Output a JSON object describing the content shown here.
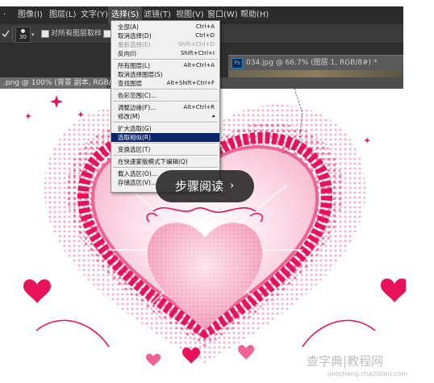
{
  "menubar": {
    "items": [
      {
        "label": "图像(I)",
        "active": false
      },
      {
        "label": "图层(L)",
        "active": false
      },
      {
        "label": "文字(Y)",
        "active": false
      },
      {
        "label": "选择(S)",
        "active": true
      },
      {
        "label": "滤镜(T)",
        "active": false
      },
      {
        "label": "视图(V)",
        "active": false
      },
      {
        "label": "窗口(W)",
        "active": false
      },
      {
        "label": "帮助(H)",
        "active": false
      }
    ]
  },
  "options_bar": {
    "brush_size": "30",
    "sample_all_layers_label": "对所有图层取样"
  },
  "documents": {
    "active_tab_label": ".png @ 100% (背景 副本, RGB/8) *",
    "second_window_label": "034.jpg @ 66.7% (图层 1, RGB/8#) *",
    "ps_icon_text": "Ps"
  },
  "select_menu": {
    "rows": [
      {
        "label": "全部(A)",
        "shortcut": "Ctrl+A",
        "state": "normal"
      },
      {
        "label": "取消选择(D)",
        "shortcut": "Ctrl+D",
        "state": "normal"
      },
      {
        "label": "重新选择(E)",
        "shortcut": "Shift+Ctrl+D",
        "state": "disabled"
      },
      {
        "label": "反向(I)",
        "shortcut": "Shift+Ctrl+I",
        "state": "normal"
      },
      {
        "label": "所有图层(L)",
        "shortcut": "Alt+Ctrl+A",
        "state": "normal"
      },
      {
        "label": "取消选择图层(S)",
        "shortcut": "",
        "state": "normal"
      },
      {
        "label": "查找图层",
        "shortcut": "Alt+Shift+Ctrl+F",
        "state": "normal"
      },
      {
        "label": "色彩范围(C)...",
        "shortcut": "",
        "state": "normal"
      },
      {
        "label": "调整边缘(F)...",
        "shortcut": "Alt+Ctrl+R",
        "state": "normal"
      },
      {
        "label": "修改(M)",
        "shortcut": "",
        "state": "submenu"
      },
      {
        "label": "扩大选取(G)",
        "shortcut": "",
        "state": "normal"
      },
      {
        "label": "选取相似(R)",
        "shortcut": "",
        "state": "highlight"
      },
      {
        "label": "变换选区(T)",
        "shortcut": "",
        "state": "normal"
      },
      {
        "label": "在快速蒙版模式下编辑(Q)",
        "shortcut": "",
        "state": "normal"
      },
      {
        "label": "载入选区(O)...",
        "shortcut": "",
        "state": "normal"
      },
      {
        "label": "存储选区(V)...",
        "shortcut": "",
        "state": "normal"
      }
    ],
    "submenu_arrow": "▸"
  },
  "step_pill": {
    "label": "步骤阅读",
    "chevron": "›"
  },
  "watermark": {
    "main": "查字典|教程网",
    "sub": "jiaocheng.chazidian.com"
  },
  "colors": {
    "deep_pink": "#e8125a",
    "mid_pink": "#f06292",
    "light_pink": "#f8bbd0",
    "pale_pink": "#fce4ec",
    "highlight_blue": "#0a246a"
  }
}
